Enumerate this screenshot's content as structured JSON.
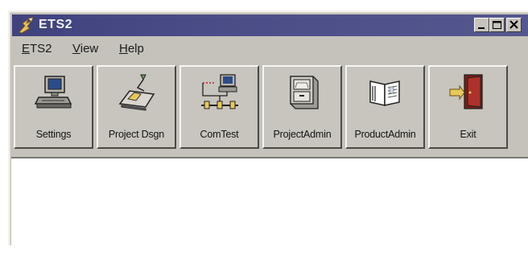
{
  "window": {
    "title": "ETS2",
    "colors": {
      "titlebar": "#44467f",
      "face": "#c4c2ba",
      "client": "#ffffff"
    },
    "controls": [
      "minimize-icon",
      "maximize-icon",
      "close-icon"
    ]
  },
  "menu": {
    "items": [
      {
        "accel": "E",
        "rest": "TS2"
      },
      {
        "accel": "V",
        "rest": "iew"
      },
      {
        "accel": "H",
        "rest": "elp"
      }
    ]
  },
  "toolbar": {
    "buttons": [
      {
        "label": "Settings",
        "icon": "computer-icon"
      },
      {
        "label": "Project Dsgn",
        "icon": "drafting-table-icon"
      },
      {
        "label": "ComTest",
        "icon": "network-test-icon"
      },
      {
        "label": "ProjectAdmin",
        "icon": "file-cabinet-icon"
      },
      {
        "label": "ProductAdmin",
        "icon": "open-book-icon"
      },
      {
        "label": "Exit",
        "icon": "exit-door-icon"
      }
    ]
  }
}
